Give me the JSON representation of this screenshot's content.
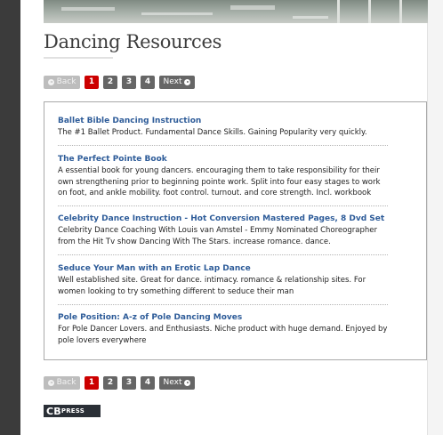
{
  "page": {
    "title": "Dancing Resources"
  },
  "pagination": {
    "back_label": "Back",
    "next_label": "Next",
    "pages": [
      "1",
      "2",
      "3",
      "4"
    ],
    "active_page": "1"
  },
  "items": [
    {
      "title": "Ballet Bible Dancing Instruction",
      "description": "The #1 Ballet Product. Fundamental Dance Skills. Gaining Popularity very quickly."
    },
    {
      "title": "The Perfect Pointe Book",
      "description": "A essential book for young dancers. encouraging them to take responsibility for their own strengthening prior to beginning pointe work. Split into four easy stages to work on foot, and ankle mobility. foot control. turnout. and core strength. Incl. workbook"
    },
    {
      "title": "Celebrity Dance Instruction - Hot Conversion Mastered Pages, 8 Dvd Set",
      "description": "Celebrity Dance Coaching With Louis van Amstel - Emmy Nominated Choreographer from the Hit Tv show Dancing With The Stars. increase romance. dance."
    },
    {
      "title": "Seduce Your Man with an Erotic Lap Dance",
      "description": "Well established site. Great for dance. intimacy. romance & relationship sites. For women looking to try something different to seduce their man"
    },
    {
      "title": "Pole Position: A-z of Pole Dancing Moves",
      "description": "For Pole Dancer Lovers. and Enthusiasts. Niche product with huge demand. Enjoyed by pole lovers everywhere"
    }
  ],
  "footer": {
    "logo_cb": "CB",
    "logo_press": "PRESS"
  },
  "colors": {
    "active_page": "#cc0000",
    "link": "#2e5c99",
    "sidebar": "#3b3b3b"
  }
}
